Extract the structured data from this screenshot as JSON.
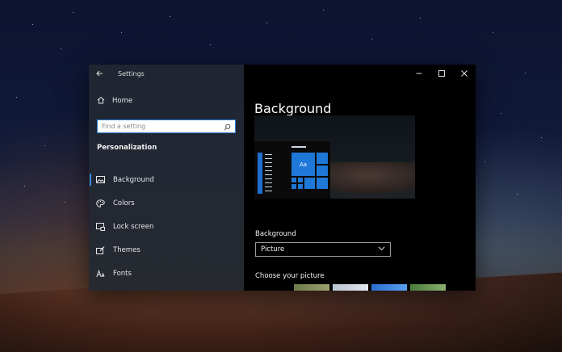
{
  "window": {
    "title": "Settings"
  },
  "sidebar": {
    "home_label": "Home",
    "search_placeholder": "Find a setting",
    "section_label": "Personalization",
    "items": [
      {
        "label": "Background",
        "icon": "picture-icon",
        "active": true
      },
      {
        "label": "Colors",
        "icon": "palette-icon",
        "active": false
      },
      {
        "label": "Lock screen",
        "icon": "lock-screen-icon",
        "active": false
      },
      {
        "label": "Themes",
        "icon": "themes-brush-icon",
        "active": false
      },
      {
        "label": "Fonts",
        "icon": "fonts-icon",
        "active": false
      }
    ]
  },
  "main": {
    "title": "Background",
    "preview": {
      "tile_label": "Aa"
    },
    "background_field": {
      "label": "Background",
      "value": "Picture"
    },
    "choose_label": "Choose your picture"
  },
  "colors": {
    "accent": "#1e78d8",
    "search_border": "#2f7fd6",
    "content_bg": "#000000",
    "sidebar_bg": "#232833"
  }
}
